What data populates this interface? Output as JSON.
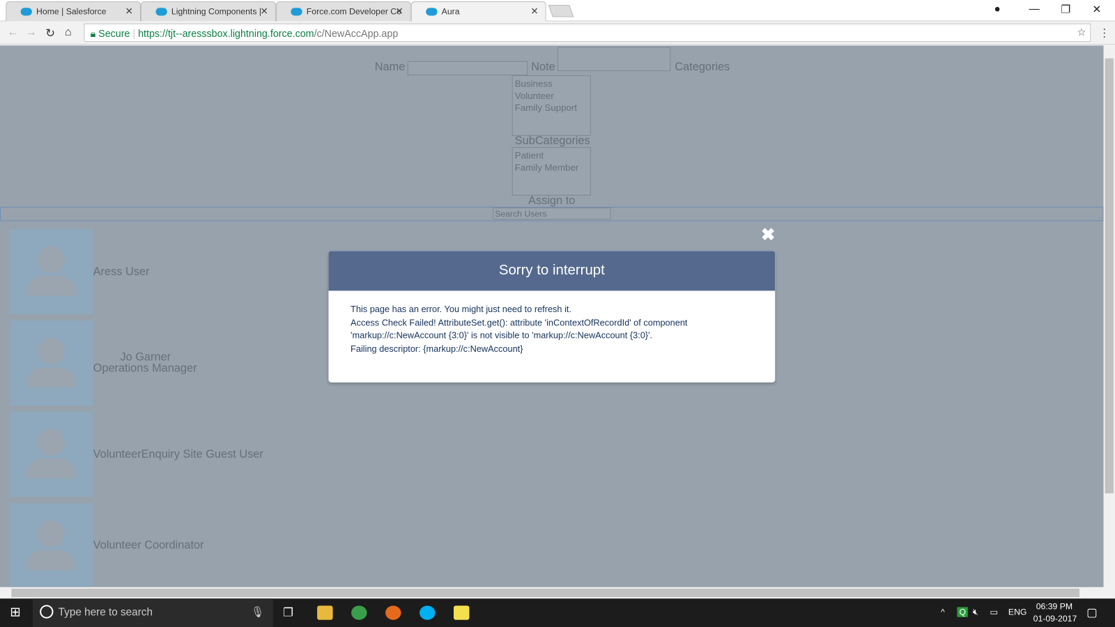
{
  "browser": {
    "tabs": [
      {
        "label": "Home | Salesforce"
      },
      {
        "label": "Lightning Components |"
      },
      {
        "label": "Force.com Developer Co"
      },
      {
        "label": "Aura"
      }
    ],
    "secure_label": "Secure",
    "url_host": "https://tjt--aresssbox.lightning.force.com",
    "url_path": "/c/NewAccApp.app"
  },
  "form": {
    "name_label": "Name",
    "note_label": "Note",
    "categories_label": "Categories",
    "categories": [
      "Business",
      "Volunteer",
      "Family Support"
    ],
    "subcategories_label": "SubCategories",
    "subcategories": [
      "Patient",
      "Family Member"
    ],
    "assign_label": "Assign to",
    "search_placeholder": "Search Users"
  },
  "users": [
    {
      "name": "Aress User",
      "title": ""
    },
    {
      "name": "Jo Garner",
      "title": "Operations Manager"
    },
    {
      "name": "VolunteerEnquiry Site Guest User",
      "title": ""
    },
    {
      "name": "Volunteer Coordinator",
      "title": ""
    }
  ],
  "modal": {
    "title": "Sorry to interrupt",
    "lines": [
      "This page has an error. You might just need to refresh it.",
      "Access Check Failed! AttributeSet.get(): attribute 'inContextOfRecordId' of component",
      "'markup://c:NewAccount {3:0}' is not visible to 'markup://c:NewAccount {3:0}'.",
      "Failing descriptor: {markup://c:NewAccount}"
    ]
  },
  "taskbar": {
    "search_placeholder": "Type here to search",
    "lang": "ENG",
    "time": "06:39 PM",
    "date": "01-09-2017"
  }
}
